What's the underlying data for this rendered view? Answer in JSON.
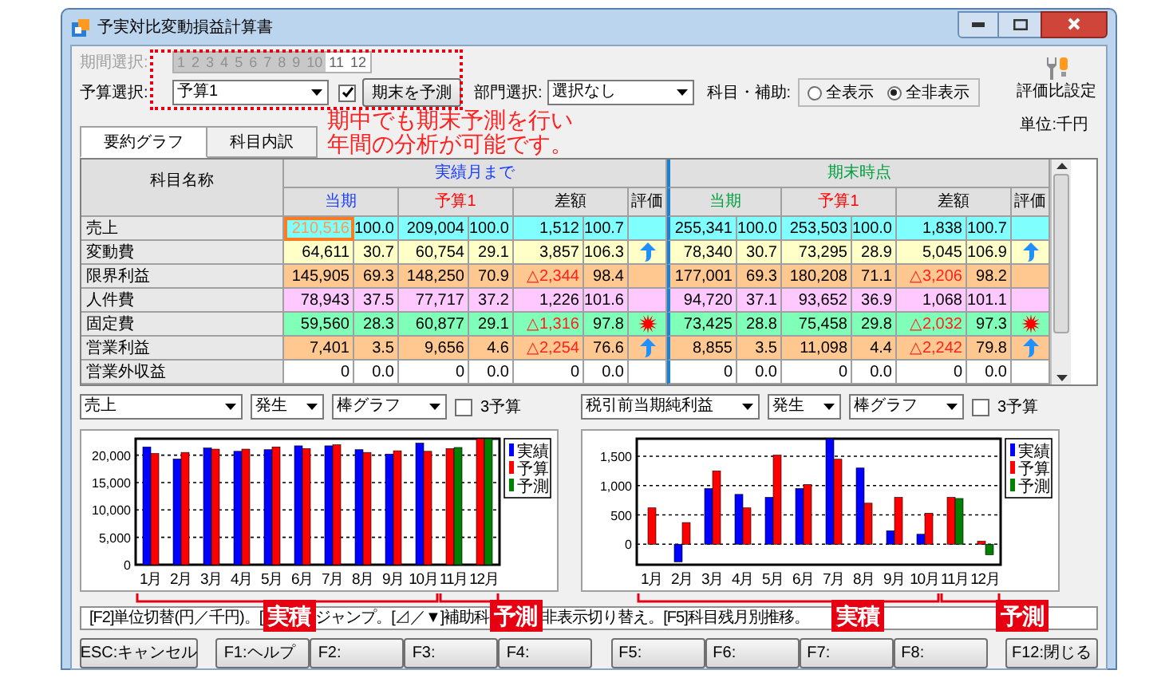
{
  "window": {
    "title": "予実対比変動損益計算書"
  },
  "period": {
    "label": "期間選択:",
    "disabled": true,
    "months": [
      {
        "label": "1",
        "disabled": true
      },
      {
        "label": "2",
        "disabled": true
      },
      {
        "label": "3",
        "disabled": true
      },
      {
        "label": "4",
        "disabled": true
      },
      {
        "label": "5",
        "disabled": true
      },
      {
        "label": "6",
        "disabled": true
      },
      {
        "label": "7",
        "disabled": true
      },
      {
        "label": "8",
        "disabled": true
      },
      {
        "label": "9",
        "disabled": true
      },
      {
        "label": "10",
        "disabled": true
      },
      {
        "label": "11",
        "disabled": false
      },
      {
        "label": "12",
        "disabled": false
      }
    ]
  },
  "budget": {
    "label": "予算選択:",
    "value": "予算1",
    "forecast_checked": true,
    "button": "期末を予測"
  },
  "department": {
    "label": "部門選択:",
    "value": "選択なし"
  },
  "subject": {
    "label": "科目・補助:",
    "options": [
      {
        "label": "全表示",
        "selected": false
      },
      {
        "label": "全非表示",
        "selected": true
      }
    ]
  },
  "settings_button": "評価比設定",
  "unit": "単位:千円",
  "tabs": [
    {
      "label": "要約グラフ",
      "selected": true
    },
    {
      "label": "科目内訳",
      "selected": false
    }
  ],
  "callout": [
    "期中でも期末予測を行い",
    "年間の分析が可能です。"
  ],
  "table": {
    "name_header": "科目名称",
    "groups": [
      {
        "title": "実績月まで",
        "color": "#1a3cff",
        "columns": [
          "当期",
          "予算1",
          "差額",
          "評価"
        ]
      },
      {
        "title": "期末時点",
        "color": "#00a040",
        "columns": [
          "当期",
          "予算1",
          "差額",
          "評価"
        ]
      }
    ],
    "rows": [
      {
        "name": "売上",
        "color": "#80ffff",
        "focused": true,
        "groups": [
          {
            "values": [
              "210,516",
              "100.0",
              "209,004",
              "100.0",
              "1,512",
              "100.7"
            ],
            "diff_negative": false,
            "eval": {
              "kind": "none"
            }
          },
          {
            "values": [
              "255,341",
              "100.0",
              "253,503",
              "100.0",
              "1,838",
              "100.7"
            ],
            "diff_negative": false,
            "eval": {
              "kind": "none"
            }
          }
        ]
      },
      {
        "name": "変動費",
        "color": "#ffffc8",
        "focused": false,
        "groups": [
          {
            "values": [
              "64,611",
              "30.7",
              "60,754",
              "29.1",
              "3,857",
              "106.3"
            ],
            "diff_negative": false,
            "eval": {
              "kind": "up"
            }
          },
          {
            "values": [
              "78,340",
              "30.7",
              "73,295",
              "28.9",
              "5,045",
              "106.9"
            ],
            "diff_negative": false,
            "eval": {
              "kind": "up"
            }
          }
        ]
      },
      {
        "name": "限界利益",
        "color": "#ffc890",
        "focused": false,
        "groups": [
          {
            "values": [
              "145,905",
              "69.3",
              "148,250",
              "70.9",
              "△2,344",
              "98.4"
            ],
            "diff_negative": true,
            "eval": {
              "kind": "none"
            }
          },
          {
            "values": [
              "177,001",
              "69.3",
              "180,208",
              "71.1",
              "△3,206",
              "98.2"
            ],
            "diff_negative": true,
            "eval": {
              "kind": "none"
            }
          }
        ]
      },
      {
        "name": "人件費",
        "color": "#ffc8ff",
        "focused": false,
        "groups": [
          {
            "values": [
              "78,943",
              "37.5",
              "77,717",
              "37.2",
              "1,226",
              "101.6"
            ],
            "diff_negative": false,
            "eval": {
              "kind": "none"
            }
          },
          {
            "values": [
              "94,720",
              "37.1",
              "93,652",
              "36.9",
              "1,068",
              "101.1"
            ],
            "diff_negative": false,
            "eval": {
              "kind": "none"
            }
          }
        ]
      },
      {
        "name": "固定費",
        "color": "#80ffb8",
        "focused": false,
        "groups": [
          {
            "values": [
              "59,560",
              "28.3",
              "60,877",
              "29.1",
              "△1,316",
              "97.8"
            ],
            "diff_negative": true,
            "eval": {
              "kind": "alert"
            }
          },
          {
            "values": [
              "73,425",
              "28.8",
              "75,458",
              "29.8",
              "△2,032",
              "97.3"
            ],
            "diff_negative": true,
            "eval": {
              "kind": "alert"
            }
          }
        ]
      },
      {
        "name": "営業利益",
        "color": "#ffc890",
        "focused": false,
        "groups": [
          {
            "values": [
              "7,401",
              "3.5",
              "9,656",
              "4.6",
              "△2,254",
              "76.6"
            ],
            "diff_negative": true,
            "eval": {
              "kind": "up"
            }
          },
          {
            "values": [
              "8,855",
              "3.5",
              "11,098",
              "4.4",
              "△2,242",
              "79.8"
            ],
            "diff_negative": true,
            "eval": {
              "kind": "up"
            }
          }
        ]
      },
      {
        "name": "営業外収益",
        "color": "#ffffff",
        "focused": false,
        "groups": [
          {
            "values": [
              "0",
              "0.0",
              "0",
              "0.0",
              "0",
              "0.0"
            ],
            "diff_negative": false,
            "eval": {
              "kind": "none"
            }
          },
          {
            "values": [
              "0",
              "0.0",
              "0",
              "0.0",
              "0",
              "0.0"
            ],
            "diff_negative": false,
            "eval": {
              "kind": "none"
            }
          }
        ]
      }
    ]
  },
  "chart_panels": [
    {
      "controls": {
        "subject": "売上",
        "mode": "発生",
        "graph": "棒グラフ",
        "three_budget_label": "3予算",
        "three_budget_checked": false
      },
      "chart_data": {
        "type": "bar",
        "categories": [
          "1月",
          "2月",
          "3月",
          "4月",
          "5月",
          "6月",
          "7月",
          "8月",
          "9月",
          "10月",
          "11月",
          "12月"
        ],
        "series": [
          {
            "name": "実績",
            "color": "#0000ff",
            "values": [
              21500,
              19300,
              21300,
              20700,
              21000,
              21700,
              21700,
              21000,
              20200,
              22200,
              null,
              null
            ]
          },
          {
            "name": "予算",
            "color": "#ff0000",
            "values": [
              20300,
              20500,
              21100,
              21100,
              21500,
              21200,
              21900,
              20500,
              20800,
              20700,
              21200,
              23000
            ]
          },
          {
            "name": "予測",
            "color": "#008000",
            "values": [
              null,
              null,
              null,
              null,
              null,
              null,
              null,
              null,
              null,
              null,
              21400,
              23000
            ]
          }
        ],
        "ylim": [
          0,
          23000
        ],
        "yticks": [
          {
            "value": 0,
            "label": "0"
          },
          {
            "value": 5000,
            "label": "5,000"
          },
          {
            "value": 10000,
            "label": "10,000"
          },
          {
            "value": 15000,
            "label": "15,000"
          },
          {
            "value": 20000,
            "label": "20,000"
          }
        ],
        "grid": true,
        "legend": true
      },
      "brackets": [
        {
          "label": "実積"
        },
        {
          "label": "予測"
        }
      ]
    },
    {
      "controls": {
        "subject": "税引前当期純利益",
        "mode": "発生",
        "graph": "棒グラフ",
        "three_budget_label": "3予算",
        "three_budget_checked": false
      },
      "chart_data": {
        "type": "bar",
        "categories": [
          "1月",
          "2月",
          "3月",
          "4月",
          "5月",
          "6月",
          "7月",
          "8月",
          "9月",
          "10月",
          "11月",
          "12月"
        ],
        "series": [
          {
            "name": "実績",
            "color": "#0000ff",
            "values": [
              null,
              -300,
              950,
              850,
              800,
              950,
              1800,
              1300,
              230,
              170,
              null,
              null
            ]
          },
          {
            "name": "予算",
            "color": "#ff0000",
            "values": [
              620,
              370,
              1250,
              620,
              1520,
              1020,
              1450,
              700,
              800,
              530,
              800,
              50
            ]
          },
          {
            "name": "予測",
            "color": "#008000",
            "values": [
              null,
              null,
              null,
              null,
              null,
              null,
              null,
              null,
              null,
              null,
              780,
              -180
            ]
          }
        ],
        "ylim": [
          -350,
          1800
        ],
        "yticks": [
          {
            "value": 0,
            "label": "0"
          },
          {
            "value": 500,
            "label": "500"
          },
          {
            "value": 1000,
            "label": "1,000"
          },
          {
            "value": 1500,
            "label": "1,500"
          }
        ],
        "grid": true,
        "legend": true
      },
      "brackets": [
        {
          "label": "実積"
        },
        {
          "label": "予測"
        }
      ]
    }
  ],
  "status_texts": [
    "[F2]単位切替(円／千円)。[",
    "ジャンプ。[⊿／▼]補助科",
    "非表示切り替え。[F5]科目残月別推移。"
  ],
  "function_keys": [
    [
      "ESC:キャンセル"
    ],
    [
      "F1:ヘルプ",
      "F2:",
      "F3:",
      "F4:"
    ],
    [
      "F5:",
      "F6:",
      "F7:",
      "F8:"
    ],
    [
      "F12:閉じる"
    ]
  ]
}
